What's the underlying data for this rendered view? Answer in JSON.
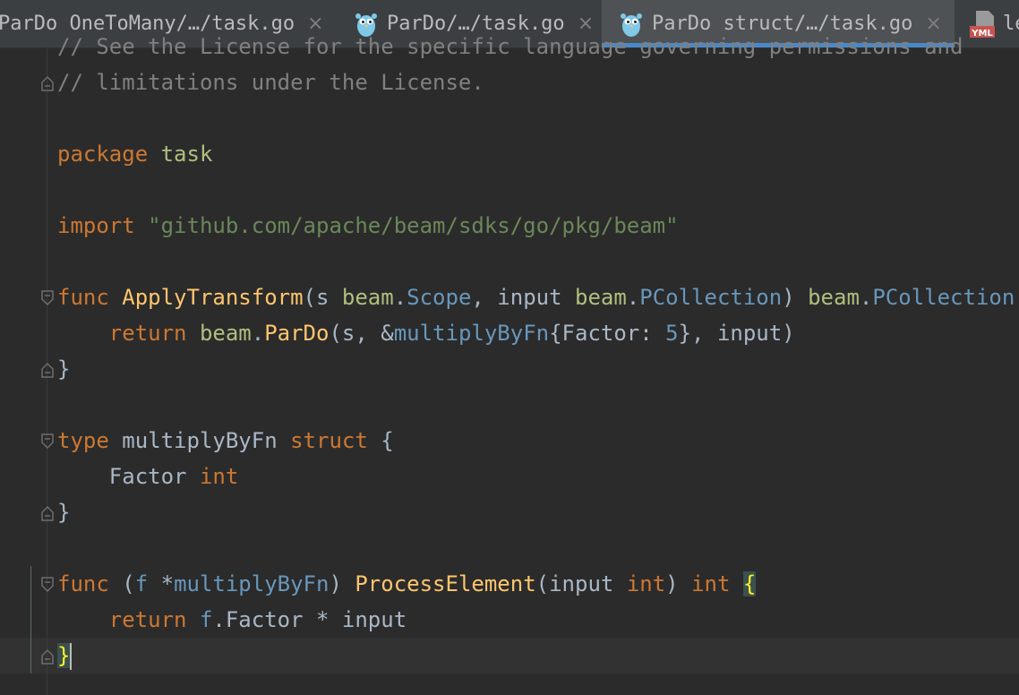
{
  "tabs": [
    {
      "label": "ParDo OneToMany/…/task.go",
      "close": "×",
      "icon": "none",
      "active": false
    },
    {
      "label": "ParDo/…/task.go",
      "close": "×",
      "icon": "gopher-icon",
      "active": false
    },
    {
      "label": "ParDo struct/…/task.go",
      "close": "×",
      "icon": "gopher-icon",
      "active": true
    },
    {
      "label": "le",
      "icon": "yml-file-icon",
      "icon_text": "YML",
      "active": false
    }
  ],
  "editor": {
    "lines": {
      "l0": {
        "comment": "// See the License for the specific language governing permissions and"
      },
      "l1": {
        "comment": "// limitations under the License."
      },
      "l3": {
        "kw": "package",
        "sp": " ",
        "name": "task"
      },
      "l5": {
        "kw": "import",
        "sp": " ",
        "path": "\"github.com/apache/beam/sdks/go/pkg/beam\""
      },
      "l7": {
        "kw": "func",
        "sp": " ",
        "fn": "ApplyTransform",
        "p1": "(s ",
        "pkg1": "beam",
        "dot1": ".",
        "t1": "Scope",
        "p2": ", input ",
        "pkg2": "beam",
        "dot2": ".",
        "t2": "PCollection",
        "p3": ") ",
        "pkg3": "beam",
        "dot3": ".",
        "t3": "PCollection",
        "p4": " {"
      },
      "l8": {
        "indent": "    ",
        "kw": "return",
        "sp": " ",
        "pkg": "beam",
        "dot": ".",
        "fn": "ParDo",
        "p1": "(s, &",
        "t": "multiplyByFn",
        "p2": "{Factor: ",
        "num": "5",
        "p3": "}, input)"
      },
      "l9": {
        "text": "}"
      },
      "l11": {
        "kw1": "type",
        "mid": " multiplyByFn ",
        "kw2": "struct",
        "end": " {"
      },
      "l12": {
        "indent": "    Factor ",
        "kw": "int"
      },
      "l13": {
        "text": "}"
      },
      "l15": {
        "kw": "func",
        "p1": " (",
        "recv": "f",
        "star": " *",
        "t": "multiplyByFn",
        "p2": ") ",
        "fn": "ProcessElement",
        "p3": "(input ",
        "kw2": "int",
        "p4": ") ",
        "kw3": "int",
        "sp": " ",
        "brace": "{"
      },
      "l16": {
        "indent": "    ",
        "kw": "return",
        "sp": " ",
        "recv": "f",
        "rest": ".Factor * input"
      },
      "l17": {
        "brace": "}"
      }
    }
  },
  "colors": {
    "background": "#2b2b2b",
    "tab_active_underline": "#4a88c7",
    "keyword": "#cc7832",
    "function": "#ffc66d",
    "string": "#6a8759",
    "type": "#6897bb",
    "comment": "#808080",
    "text": "#a9b7c6"
  }
}
